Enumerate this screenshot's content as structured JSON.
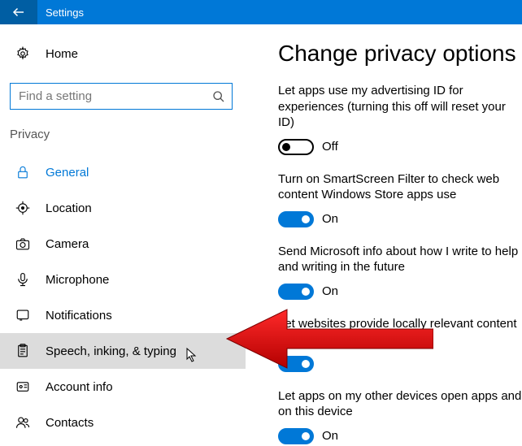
{
  "titlebar": {
    "title": "Settings"
  },
  "sidebar": {
    "home": "Home",
    "search_placeholder": "Find a setting",
    "section": "Privacy",
    "items": [
      {
        "label": "General"
      },
      {
        "label": "Location"
      },
      {
        "label": "Camera"
      },
      {
        "label": "Microphone"
      },
      {
        "label": "Notifications"
      },
      {
        "label": "Speech, inking, & typing"
      },
      {
        "label": "Account info"
      },
      {
        "label": "Contacts"
      }
    ]
  },
  "main": {
    "heading": "Change privacy options",
    "blocks": [
      {
        "text": "Let apps use my advertising ID for experiences (turning this off will reset your ID)",
        "state": "off",
        "label": "Off"
      },
      {
        "text": "Turn on SmartScreen Filter to check web content Windows Store apps use",
        "state": "on",
        "label": "On"
      },
      {
        "text": "Send Microsoft info about how I write to help and writing in the future",
        "state": "on",
        "label": "On"
      },
      {
        "text": "Let websites provide locally relevant content by language list",
        "state": "on",
        "label": ""
      },
      {
        "text": "Let apps on my other devices open apps and on this device",
        "state": "on",
        "label": "On"
      }
    ]
  }
}
